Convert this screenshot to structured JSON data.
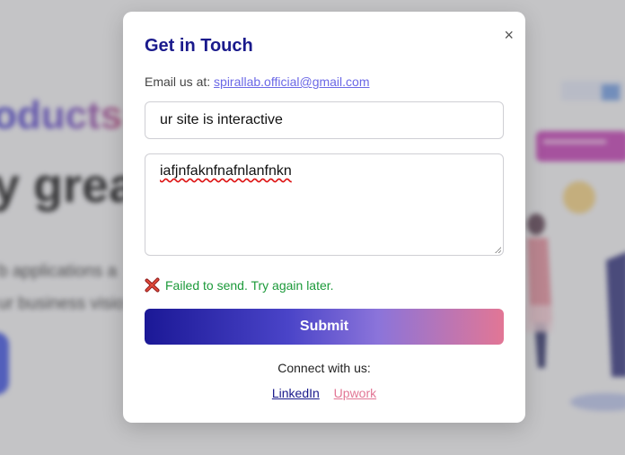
{
  "background": {
    "heading_fragment": "oducts",
    "heading_fragment_2": "y grea",
    "line1_fragment": "b applications a",
    "line2_fragment": "ur business visio"
  },
  "modal": {
    "title": "Get in Touch",
    "close_glyph": "×",
    "email_label": "Email us at:",
    "email_link": "spirallab.official@gmail.com",
    "subject_value": "ur site is interactive",
    "message_value": "iafjnfaknfnafnlanfnkn",
    "status_text": "Failed to send. Try again later.",
    "status_icon": "cross-mark-icon",
    "submit_label": "Submit",
    "connect_label": "Connect with us:",
    "links": {
      "linkedin": "LinkedIn",
      "upwork": "Upwork"
    }
  },
  "colors": {
    "title": "#1a1a8c",
    "email_link": "#6b68e6",
    "status_error_text": "#1c9a3a",
    "submit_gradient_start": "#1b1896",
    "submit_gradient_end": "#e27695",
    "linkedin": "#1a1a8c",
    "upwork": "#e27695"
  }
}
